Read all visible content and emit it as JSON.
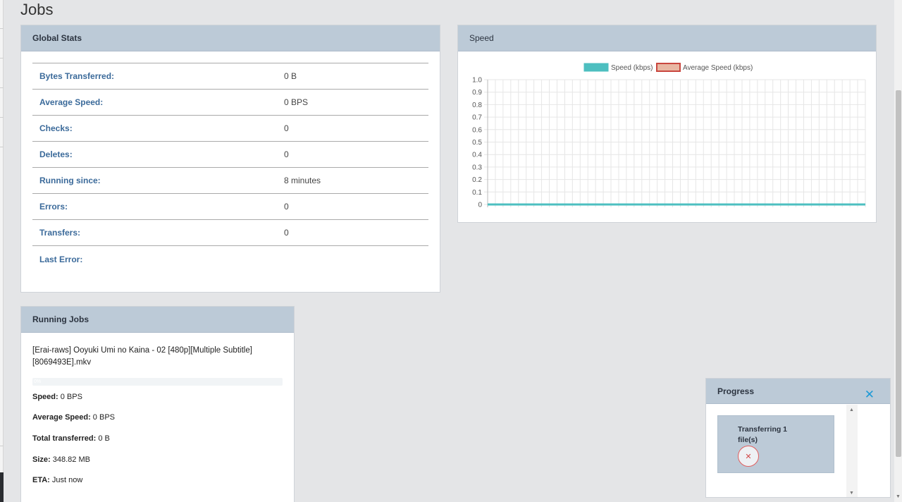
{
  "page": {
    "title": "Jobs"
  },
  "global_stats": {
    "title": "Global Stats",
    "rows": [
      {
        "label": "Bytes Transferred:",
        "value": "0 B"
      },
      {
        "label": "Average Speed:",
        "value": "0 BPS"
      },
      {
        "label": "Checks:",
        "value": "0"
      },
      {
        "label": "Deletes:",
        "value": "0"
      },
      {
        "label": "Running since:",
        "value": "8 minutes"
      },
      {
        "label": "Errors:",
        "value": "0"
      },
      {
        "label": "Transfers:",
        "value": "0"
      },
      {
        "label": "Last Error:",
        "value": ""
      }
    ]
  },
  "speed": {
    "title": "Speed",
    "chart_data": {
      "type": "line",
      "series": [
        {
          "name": "Speed (kbps)",
          "color": "#4dbfc0",
          "fill": "#4dbfc0",
          "values": [
            0,
            0,
            0,
            0,
            0,
            0,
            0,
            0,
            0,
            0,
            0,
            0,
            0,
            0,
            0,
            0,
            0,
            0,
            0,
            0,
            0,
            0,
            0,
            0,
            0,
            0,
            0,
            0,
            0,
            0,
            0,
            0,
            0,
            0,
            0,
            0,
            0,
            0,
            0,
            0,
            0,
            0,
            0,
            0,
            0,
            0,
            0,
            0,
            0,
            0
          ]
        },
        {
          "name": "Average Speed (kbps)",
          "color": "#c9473f",
          "fill": "#e8b7a3",
          "values": [
            0,
            0,
            0,
            0,
            0,
            0,
            0,
            0,
            0,
            0,
            0,
            0,
            0,
            0,
            0,
            0,
            0,
            0,
            0,
            0,
            0,
            0,
            0,
            0,
            0,
            0,
            0,
            0,
            0,
            0,
            0,
            0,
            0,
            0,
            0,
            0,
            0,
            0,
            0,
            0,
            0,
            0,
            0,
            0,
            0,
            0,
            0,
            0,
            0,
            0
          ]
        }
      ],
      "yticks": [
        "0",
        "0.1",
        "0.2",
        "0.3",
        "0.4",
        "0.5",
        "0.6",
        "0.7",
        "0.8",
        "0.9",
        "1.0"
      ],
      "ylim": [
        0,
        1
      ],
      "grid": true,
      "legend": "top"
    }
  },
  "running_jobs": {
    "title": "Running Jobs",
    "job": {
      "name": "[Erai-raws] Ooyuki Umi no Kaina - 02 [480p][Multiple Subtitle][8069493E].mkv",
      "percent_label": "0%",
      "progress": 0,
      "speed_label": "Speed:",
      "speed": " 0 BPS",
      "avg_speed_label": "Average Speed:",
      "avg_speed": " 0 BPS",
      "total_label": "Total transferred:",
      "total": " 0 B",
      "size_label": "Size:",
      "size": " 348.82 MB",
      "eta_label": "ETA:",
      "eta": " Just now"
    }
  },
  "progress_panel": {
    "title": "Progress",
    "close_icon": "close-x-icon",
    "transfer_text": "Transferring 1 file(s)",
    "cancel_icon": "cancel-x-icon"
  }
}
